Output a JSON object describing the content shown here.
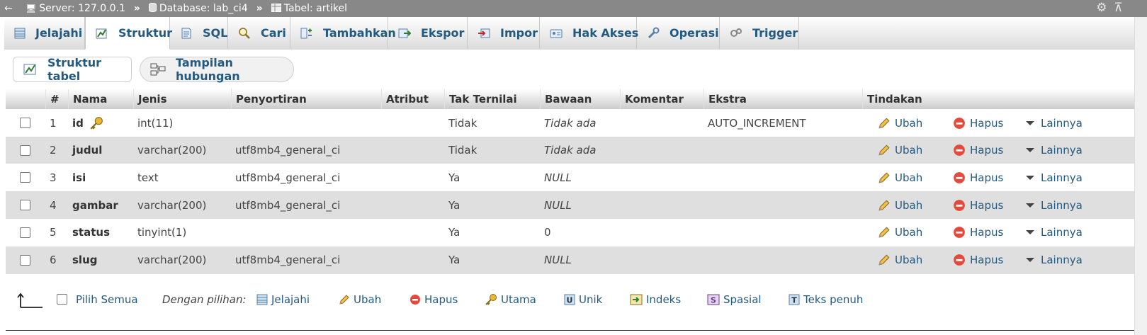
{
  "breadcrumb": {
    "server": "Server: 127.0.0.1",
    "database": "Database: lab_ci4",
    "table": "Tabel: artikel",
    "sep": "»"
  },
  "tabs": [
    {
      "label": "Jelajahi",
      "icon": "browse-icon"
    },
    {
      "label": "Struktur",
      "icon": "structure-icon",
      "active": true
    },
    {
      "label": "SQL",
      "icon": "sql-icon"
    },
    {
      "label": "Cari",
      "icon": "search-icon"
    },
    {
      "label": "Tambahkan",
      "icon": "insert-icon"
    },
    {
      "label": "Ekspor",
      "icon": "export-icon"
    },
    {
      "label": "Impor",
      "icon": "import-icon"
    },
    {
      "label": "Hak Akses",
      "icon": "privileges-icon"
    },
    {
      "label": "Operasi",
      "icon": "operations-icon"
    },
    {
      "label": "Trigger",
      "icon": "trigger-icon"
    }
  ],
  "subtabs": {
    "structure_label": "Struktur tabel",
    "relation_label": "Tampilan hubungan"
  },
  "columns": [
    "#",
    "Nama",
    "Jenis",
    "Penyortiran",
    "Atribut",
    "Tak Ternilai",
    "Bawaan",
    "Komentar",
    "Ekstra",
    "Tindakan"
  ],
  "rows": [
    {
      "num": "1",
      "name": "id",
      "primary": true,
      "type": "int(11)",
      "collation": "",
      "attribute": "",
      "null": "Tidak",
      "default": "Tidak ada",
      "default_italic": true,
      "comment": "",
      "extra": "AUTO_INCREMENT"
    },
    {
      "num": "2",
      "name": "judul",
      "primary": false,
      "type": "varchar(200)",
      "collation": "utf8mb4_general_ci",
      "attribute": "",
      "null": "Tidak",
      "default": "Tidak ada",
      "default_italic": true,
      "comment": "",
      "extra": ""
    },
    {
      "num": "3",
      "name": "isi",
      "primary": false,
      "type": "text",
      "collation": "utf8mb4_general_ci",
      "attribute": "",
      "null": "Ya",
      "default": "NULL",
      "default_italic": true,
      "comment": "",
      "extra": ""
    },
    {
      "num": "4",
      "name": "gambar",
      "primary": false,
      "type": "varchar(200)",
      "collation": "utf8mb4_general_ci",
      "attribute": "",
      "null": "Ya",
      "default": "NULL",
      "default_italic": true,
      "comment": "",
      "extra": ""
    },
    {
      "num": "5",
      "name": "status",
      "primary": false,
      "type": "tinyint(1)",
      "collation": "",
      "attribute": "",
      "null": "Ya",
      "default": "0",
      "default_italic": false,
      "comment": "",
      "extra": ""
    },
    {
      "num": "6",
      "name": "slug",
      "primary": false,
      "type": "varchar(200)",
      "collation": "utf8mb4_general_ci",
      "attribute": "",
      "null": "Ya",
      "default": "NULL",
      "default_italic": true,
      "comment": "",
      "extra": ""
    }
  ],
  "row_actions": {
    "edit": "Ubah",
    "drop": "Hapus",
    "more": "Lainnya"
  },
  "footer": {
    "check_all": "Pilih Semua",
    "with_selected": "Dengan pilihan:",
    "actions": [
      {
        "label": "Jelajahi",
        "icon": "browse-icon"
      },
      {
        "label": "Ubah",
        "icon": "pencil-icon"
      },
      {
        "label": "Hapus",
        "icon": "delete-icon"
      },
      {
        "label": "Utama",
        "icon": "primary-key-icon"
      },
      {
        "label": "Unik",
        "icon": "unique-icon"
      },
      {
        "label": "Indeks",
        "icon": "index-icon"
      },
      {
        "label": "Spasial",
        "icon": "spatial-icon"
      },
      {
        "label": "Teks penuh",
        "icon": "fulltext-icon"
      }
    ]
  },
  "colors": {
    "link": "#235a81",
    "topbar": "#888888",
    "row_alt": "#dfdfdf"
  }
}
